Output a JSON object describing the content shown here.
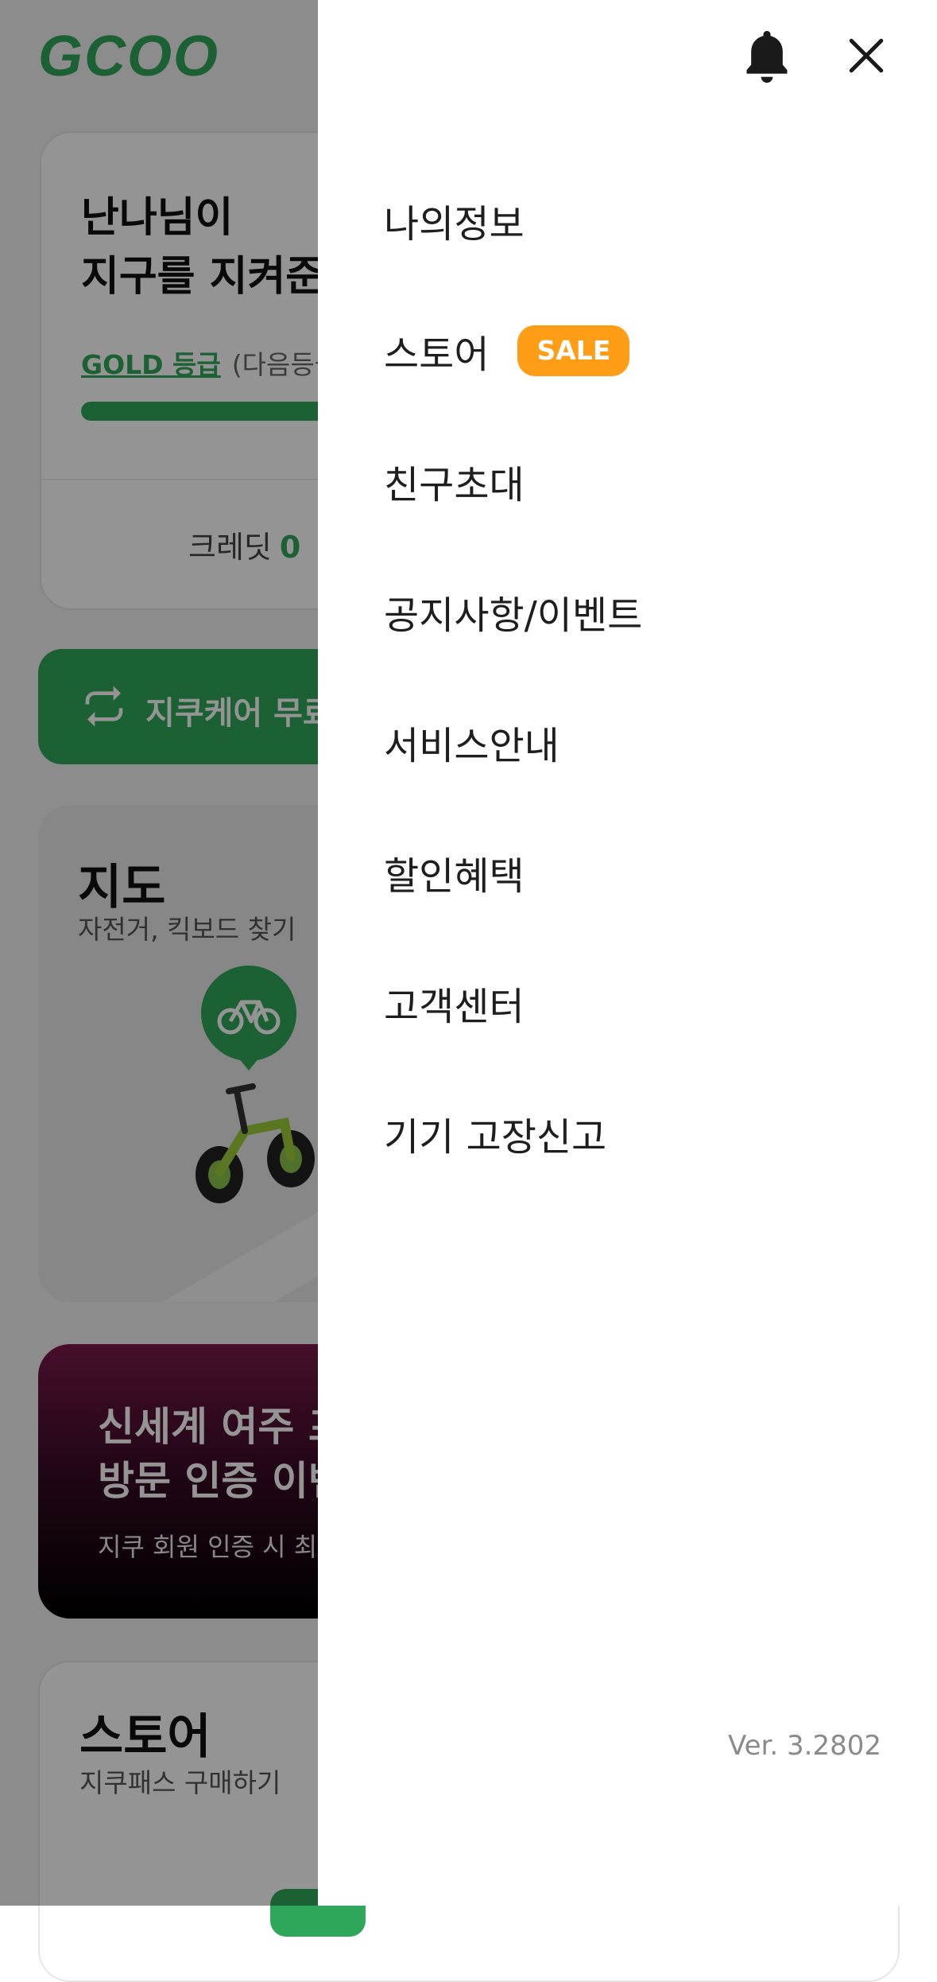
{
  "app": {
    "logo_text": "GCOO",
    "profile": {
      "greeting_line1": "난나님이",
      "greeting_line2": "지구를 지켜준",
      "grade_link": "GOLD 등급",
      "grade_hint": "(다음등급",
      "grade_progress": 0.55,
      "credit_label": "크레딧",
      "credit_value": "0"
    },
    "care_button": {
      "label": "지쿠케어 무료",
      "icon": "refresh-icon"
    },
    "map_card": {
      "title": "지도",
      "subtitle": "자전거, 킥보드 찾기"
    },
    "promo_card": {
      "title_line1": "신세계 여주 프",
      "title_line2": "방문 인증 이벤",
      "subtitle": "지쿠 회원 인증 시 최"
    },
    "store_card": {
      "title": "스토어",
      "subtitle": "지쿠패스 구매하기"
    }
  },
  "drawer": {
    "notification_icon": "bell-icon",
    "close_icon": "close-icon",
    "menu_items": [
      {
        "label": "나의정보"
      },
      {
        "label": "스토어",
        "badge": "SALE"
      },
      {
        "label": "친구초대"
      },
      {
        "label": "공지사항/이벤트"
      },
      {
        "label": "서비스안내"
      },
      {
        "label": "할인혜택"
      },
      {
        "label": "고객센터"
      },
      {
        "label": "기기 고장신고"
      }
    ],
    "version": "Ver. 3.2802"
  },
  "colors": {
    "brand_green": "#2fa75a",
    "sale_badge": "#ff9d17",
    "overlay": "rgba(0,0,0,0.42)"
  }
}
